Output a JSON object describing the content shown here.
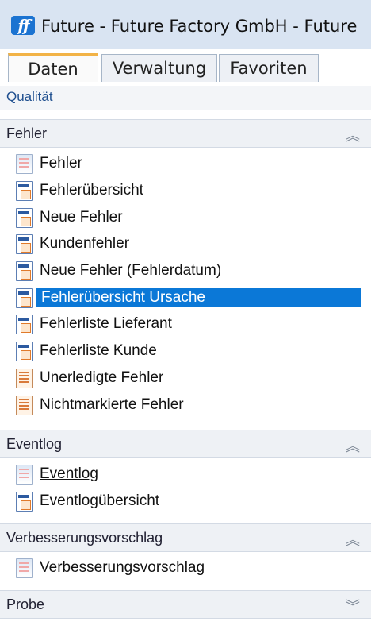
{
  "window": {
    "title": "Future - Future Factory GmbH - Future"
  },
  "tabs": [
    {
      "label": "Daten",
      "active": true
    },
    {
      "label": "Verwaltung",
      "active": false
    },
    {
      "label": "Favoriten",
      "active": false
    }
  ],
  "ribbon": {
    "label": "Qualität"
  },
  "sections": [
    {
      "title": "Fehler",
      "state_icon": "chevron-up-double-icon",
      "items": [
        {
          "label": "Fehler",
          "icon": "table-icon"
        },
        {
          "label": "Fehlerübersicht",
          "icon": "report-icon"
        },
        {
          "label": "Neue Fehler",
          "icon": "report-icon"
        },
        {
          "label": "Kundenfehler",
          "icon": "report-icon"
        },
        {
          "label": "Neue Fehler (Fehlerdatum)",
          "icon": "report-icon"
        },
        {
          "label": "Fehlerübersicht Ursache",
          "icon": "report-icon",
          "selected": true
        },
        {
          "label": "Fehlerliste Lieferant",
          "icon": "report-icon"
        },
        {
          "label": "Fehlerliste Kunde",
          "icon": "report-icon"
        },
        {
          "label": "Unerledigte Fehler",
          "icon": "list-icon"
        },
        {
          "label": "Nichtmarkierte Fehler",
          "icon": "list-icon"
        }
      ]
    },
    {
      "title": "Eventlog",
      "state_icon": "chevron-up-double-icon",
      "items": [
        {
          "label": "Eventlog",
          "icon": "table-icon",
          "underlined": true
        },
        {
          "label": "Eventlogübersicht",
          "icon": "report-icon"
        }
      ]
    },
    {
      "title": "Verbesserungsvorschlag",
      "state_icon": "chevron-up-double-icon",
      "items": [
        {
          "label": "Verbesserungsvorschlag",
          "icon": "table-icon"
        }
      ]
    },
    {
      "title": "Probe",
      "state_icon": "chevron-down-double-icon",
      "items": []
    }
  ],
  "colors": {
    "selection": "#0b78d7",
    "active_tab_accent": "#f2b347"
  }
}
